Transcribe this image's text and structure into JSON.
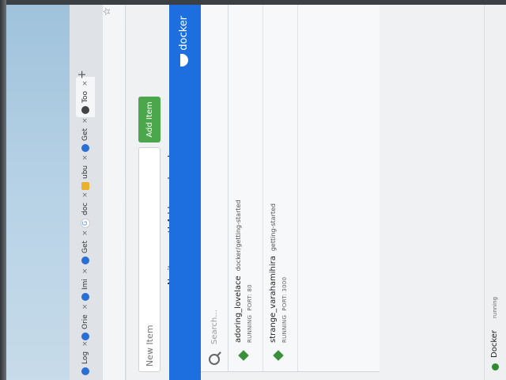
{
  "browser": {
    "tabs": [
      {
        "label": "Log",
        "icon": "docker-favicon"
      },
      {
        "label": "Orie",
        "icon": "docker-favicon"
      },
      {
        "label": "Imi",
        "icon": "docker-favicon"
      },
      {
        "label": "Get",
        "icon": "docker-favicon"
      },
      {
        "label": "doc",
        "icon": "google-favicon"
      },
      {
        "label": "ubu",
        "icon": "ubuntu-favicon"
      },
      {
        "label": "Get",
        "icon": "docker-favicon"
      },
      {
        "label": "Too",
        "icon": "github-favicon"
      }
    ],
    "tab_close": "×",
    "new_tab": "+",
    "bookmark": "☆"
  },
  "todo": {
    "input_placeholder": "New Item",
    "add_button": "Add Item",
    "empty_message": "No items yet! Add one above!"
  },
  "dashboard": {
    "brand": "docker",
    "search_placeholder": "Search...",
    "containers": [
      {
        "name": "adoring_lovelace",
        "image": "docker/getting-started",
        "status": "RUNNING",
        "port": "PORT: 80"
      },
      {
        "name": "strange_varahamihira",
        "image": "getting-started",
        "status": "RUNNING",
        "port": "PORT: 3000"
      }
    ],
    "footer_title": "Docker",
    "footer_status": "running"
  },
  "colors": {
    "docker_blue": "#1d6fe0",
    "running_green": "#2e8b2e",
    "add_button_green": "#4ca64c"
  }
}
